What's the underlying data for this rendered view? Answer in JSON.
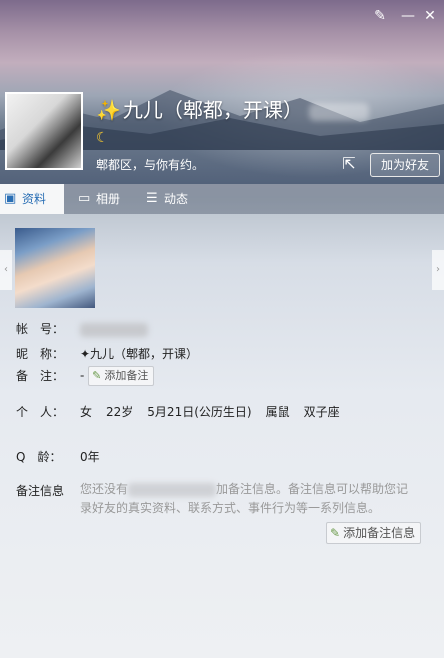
{
  "header": {
    "name": "九儿（郫都，开课）",
    "tagline": "郫都区，与你有约。",
    "add_friend_label": "加为好友"
  },
  "tabs": [
    {
      "label": "资料"
    },
    {
      "label": "相册"
    },
    {
      "label": "动态"
    }
  ],
  "profile": {
    "account_label": "帐　号：",
    "nickname_label": "昵　称：",
    "nickname_value": "✦九儿（郫都，开课）",
    "remark_label": "备　注：",
    "remark_value": "-",
    "add_remark_label": "添加备注",
    "personal_label": "个　人：",
    "gender": "女",
    "age": "22岁",
    "birthday": "5月21日(公历生日)",
    "zodiac": "属鼠",
    "constellation": "双子座",
    "qage_label": "Q　龄：",
    "qage_value": "0年",
    "note_info_label": "备注信息",
    "note_info_before": "您还没有",
    "note_info_after": "加备注信息。备注信息可以帮助您记录好友的真实资料、联系方式、事件行为等一系列信息。",
    "add_note_info_label": "添加备注信息"
  },
  "icons": {
    "titlebar": [
      "skin-icon",
      "minimize-icon",
      "close-icon"
    ],
    "share": "share-icon"
  },
  "colors": {
    "active_tab_text": "#2a6fb5",
    "moon": "#ffcf2e"
  }
}
